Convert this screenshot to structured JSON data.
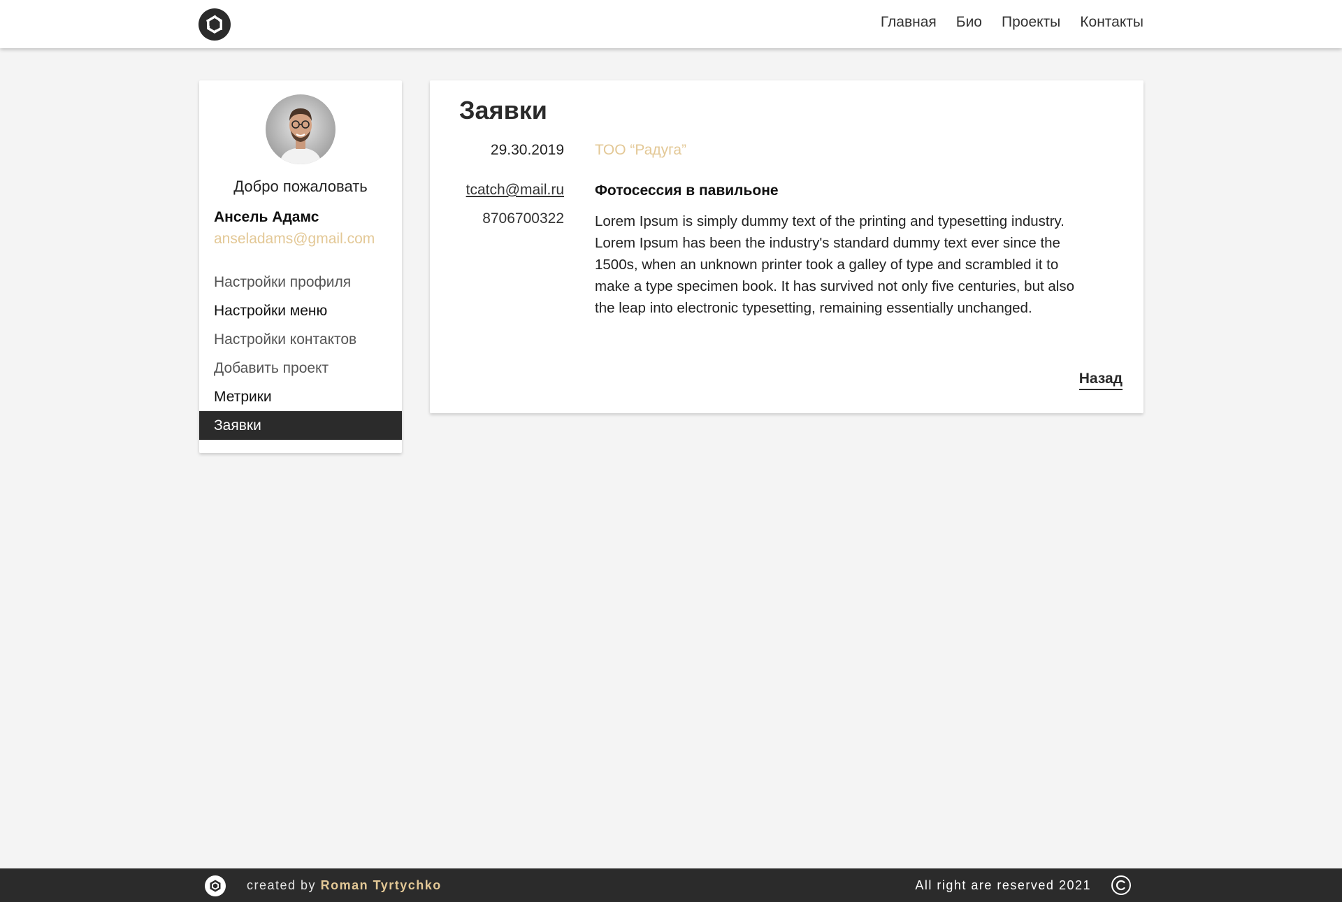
{
  "nav": {
    "items": [
      {
        "label": "Главная"
      },
      {
        "label": "Био"
      },
      {
        "label": "Проекты"
      },
      {
        "label": "Контакты"
      }
    ]
  },
  "sidebar": {
    "welcome": "Добро пожаловать",
    "user_name": "Ансель Адамс",
    "user_email": "anseladams@gmail.com",
    "menu": [
      {
        "label": "Настройки профиля"
      },
      {
        "label": "Настройки меню"
      },
      {
        "label": "Настройки контактов"
      },
      {
        "label": "Добавить проект"
      },
      {
        "label": "Метрики"
      },
      {
        "label": "Заявки"
      }
    ]
  },
  "main": {
    "title": "Заявки",
    "request": {
      "date": "29.30.2019",
      "company": "ТОО “Радуга”",
      "email": "tcatch@mail.ru",
      "phone": "8706700322",
      "subject": "Фотосессия в павильоне",
      "body": "Lorem Ipsum is simply dummy text of the printing and typesetting industry. Lorem Ipsum has been the industry's standard dummy text ever since the 1500s, when an unknown printer took a galley of type and scrambled it to make a type specimen book. It has survived not only five centuries, but also the leap into electronic typesetting, remaining essentially unchanged."
    },
    "back_label": "Назад"
  },
  "footer": {
    "credit_prefix": "created by",
    "credit_author": "Roman Tyrtychko",
    "rights": "All right are reserved 2021"
  },
  "colors": {
    "accent": "#e3c896",
    "dark": "#2b2b2b",
    "background": "#f4f4f4"
  },
  "icons": {
    "logo": "aperture-logo-icon",
    "copyright": "copyright-icon"
  }
}
